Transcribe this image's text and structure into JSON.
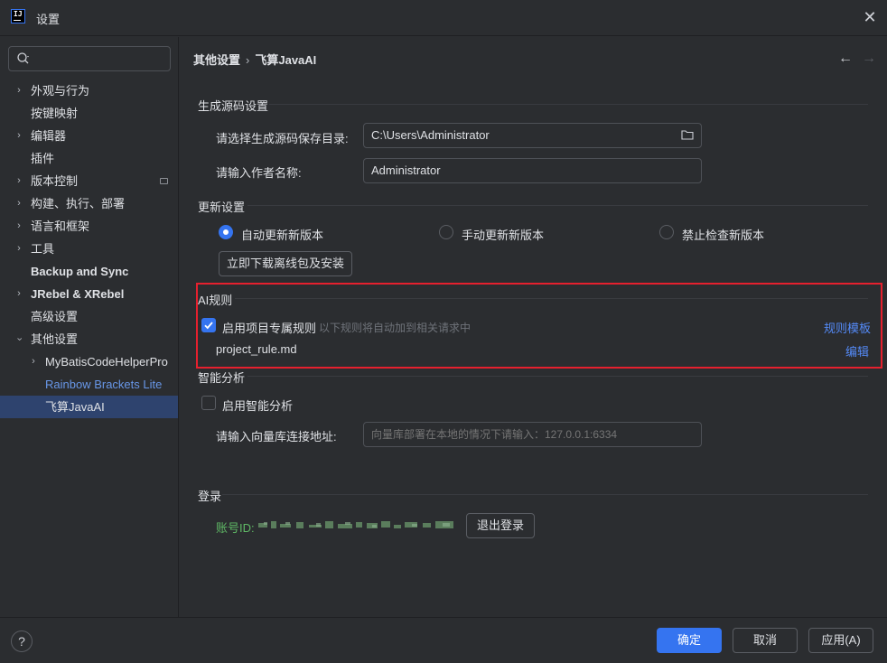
{
  "window": {
    "title": "设置",
    "close_glyph": "✕"
  },
  "sidebar": {
    "search": {
      "placeholder": ""
    },
    "items": [
      {
        "label": "外观与行为",
        "expandable": true
      },
      {
        "label": "按键映射",
        "expandable": false
      },
      {
        "label": "编辑器",
        "expandable": true
      },
      {
        "label": "插件",
        "expandable": false
      },
      {
        "label": "版本控制",
        "expandable": true
      },
      {
        "label": "构建、执行、部署",
        "expandable": true
      },
      {
        "label": "语言和框架",
        "expandable": true
      },
      {
        "label": "工具",
        "expandable": true
      },
      {
        "label": "Backup and Sync",
        "expandable": false
      },
      {
        "label": "JRebel & XRebel",
        "expandable": true
      },
      {
        "label": "高级设置",
        "expandable": false
      },
      {
        "label": "其他设置",
        "expandable": true,
        "expanded": true
      },
      {
        "label": "MyBatisCodeHelperPro",
        "expandable": true
      },
      {
        "label": "Rainbow Brackets Lite",
        "expandable": false
      },
      {
        "label": "飞算JavaAI",
        "expandable": false,
        "selected": true
      }
    ]
  },
  "breadcrumb": {
    "parent": "其他设置",
    "separator": "›",
    "current": "飞算JavaAI"
  },
  "nav": {
    "back": "←",
    "forward": "→"
  },
  "sections": {
    "codegen": {
      "title": "生成源码设置",
      "dir_label": "请选择生成源码保存目录:",
      "dir_value": "C:\\Users\\Administrator",
      "author_label": "请输入作者名称:",
      "author_value": "Administrator"
    },
    "update": {
      "title": "更新设置",
      "options": [
        "自动更新新版本",
        "手动更新新版本",
        "禁止检查新版本"
      ],
      "selected_index": 0,
      "download_button": "立即下载离线包及安装"
    },
    "ai_rules": {
      "title": "AI规则",
      "enable_label": "启用项目专属规则",
      "enable_checked": true,
      "hint": "以下规则将自动加到相关请求中",
      "template_link": "规则模板",
      "file_name": "project_rule.md",
      "edit_link": "编辑"
    },
    "smart": {
      "title": "智能分析",
      "enable_label": "启用智能分析",
      "enable_checked": false,
      "vector_label": "请输入向量库连接地址:",
      "vector_placeholder": "向量库部署在本地的情况下请输入：127.0.0.1:6334"
    },
    "login": {
      "title": "登录",
      "account_label": "账号ID:",
      "logout_button": "退出登录"
    }
  },
  "footer": {
    "help": "?",
    "ok": "确定",
    "cancel": "取消",
    "apply": "应用(A)"
  },
  "colors": {
    "background": "#2b2d30",
    "accent": "#3574f0",
    "link": "#548af7",
    "selected_row": "#2e436e",
    "highlight_box": "#e5202e",
    "account_green": "#5fb865"
  }
}
